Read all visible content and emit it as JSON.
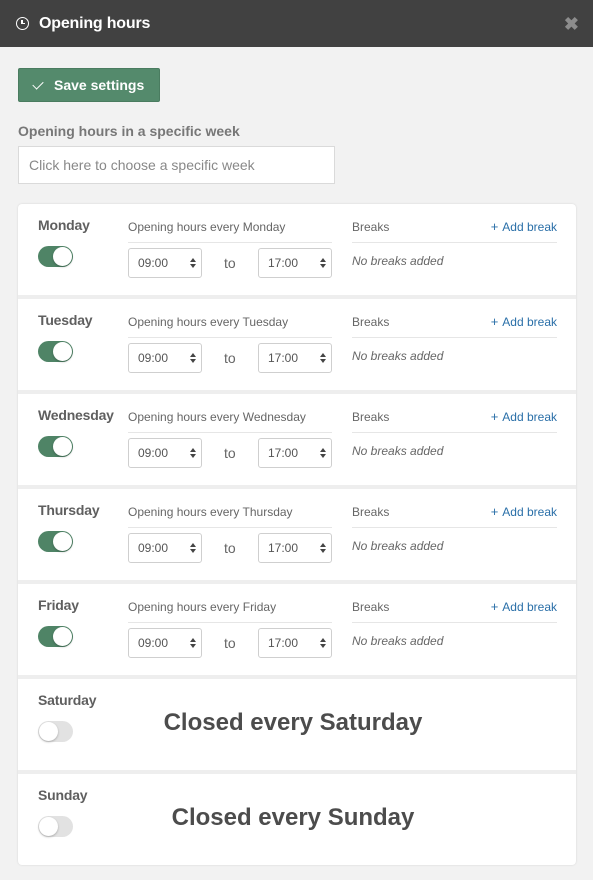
{
  "window": {
    "title": "Opening hours",
    "close_symbol": "✖",
    "icon": "clock-icon"
  },
  "toolbar": {
    "save_label": "Save settings"
  },
  "week": {
    "label": "Opening hours in a specific week",
    "placeholder": "Click here to choose a specific week",
    "value": ""
  },
  "common": {
    "to": "to",
    "breaks_label": "Breaks",
    "add_break": "Add break",
    "add_break_symbol": "+",
    "no_breaks": "No breaks added"
  },
  "days": [
    {
      "name": "Monday",
      "open": true,
      "hours_label": "Opening hours every Monday",
      "start": "09:00",
      "end": "17:00"
    },
    {
      "name": "Tuesday",
      "open": true,
      "hours_label": "Opening hours every Tuesday",
      "start": "09:00",
      "end": "17:00"
    },
    {
      "name": "Wednesday",
      "open": true,
      "hours_label": "Opening hours every Wednesday",
      "start": "09:00",
      "end": "17:00"
    },
    {
      "name": "Thursday",
      "open": true,
      "hours_label": "Opening hours every Thursday",
      "start": "09:00",
      "end": "17:00"
    },
    {
      "name": "Friday",
      "open": true,
      "hours_label": "Opening hours every Friday",
      "start": "09:00",
      "end": "17:00"
    },
    {
      "name": "Saturday",
      "open": false,
      "closed_text": "Closed every Saturday"
    },
    {
      "name": "Sunday",
      "open": false,
      "closed_text": "Closed every Sunday"
    }
  ],
  "colors": {
    "titlebar": "#414141",
    "accent_green": "#548a6c",
    "toggle_on": "#4f8466",
    "toggle_off": "#e2e2e2",
    "link_blue": "#2a6fa8"
  }
}
